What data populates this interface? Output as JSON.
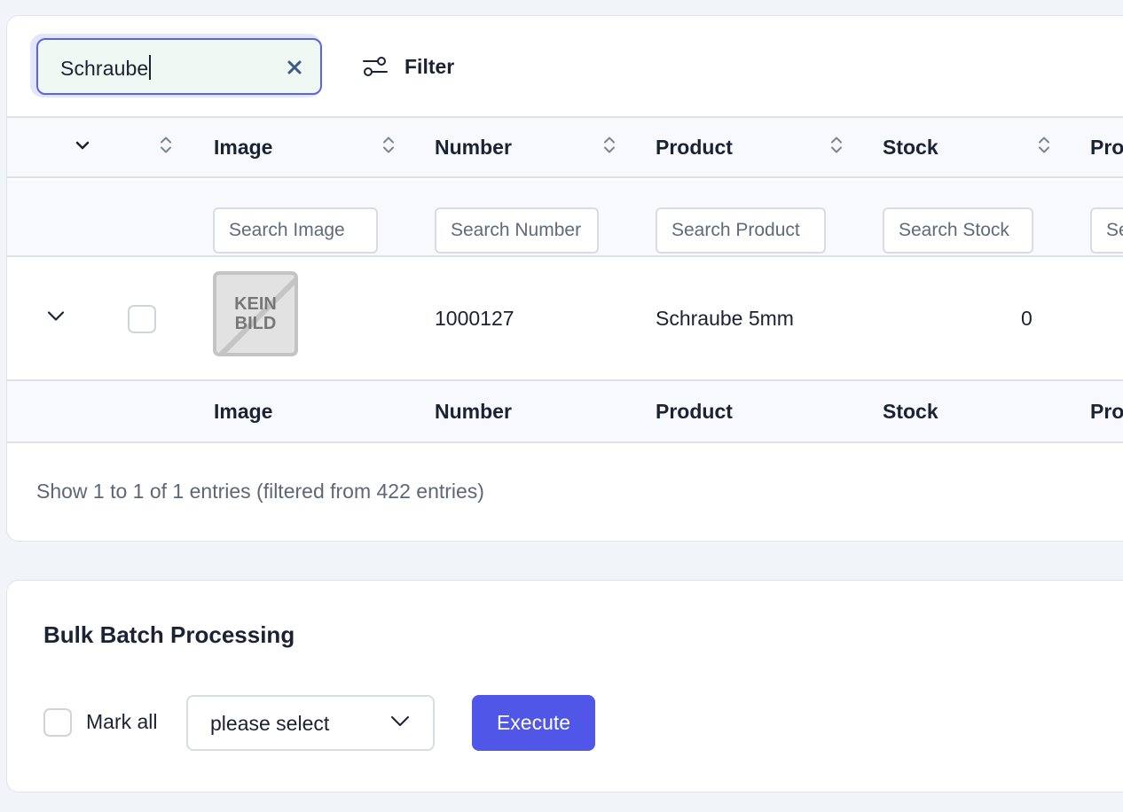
{
  "search": {
    "value": "Schraube"
  },
  "filter": {
    "label": "Filter"
  },
  "columns": [
    {
      "title": "Image",
      "placeholder": "Search Image"
    },
    {
      "title": "Number",
      "placeholder": "Search Number"
    },
    {
      "title": "Product",
      "placeholder": "Search Product"
    },
    {
      "title": "Stock",
      "placeholder": "Search Stock"
    },
    {
      "title": "Pro",
      "placeholder": "Se"
    }
  ],
  "rows": [
    {
      "image_label": "KEIN\nBILD",
      "number": "1000127",
      "product": "Schraube 5mm",
      "stock": "0"
    }
  ],
  "summary": "Show 1 to 1 of 1 entries (filtered from 422 entries)",
  "bulk": {
    "title": "Bulk Batch Processing",
    "mark_all_label": "Mark all",
    "select_value": "please select",
    "execute_label": "Execute"
  },
  "colors": {
    "accent": "#4f56e8",
    "search_border": "#5b63e6",
    "clear_icon": "#3b5a8a"
  }
}
